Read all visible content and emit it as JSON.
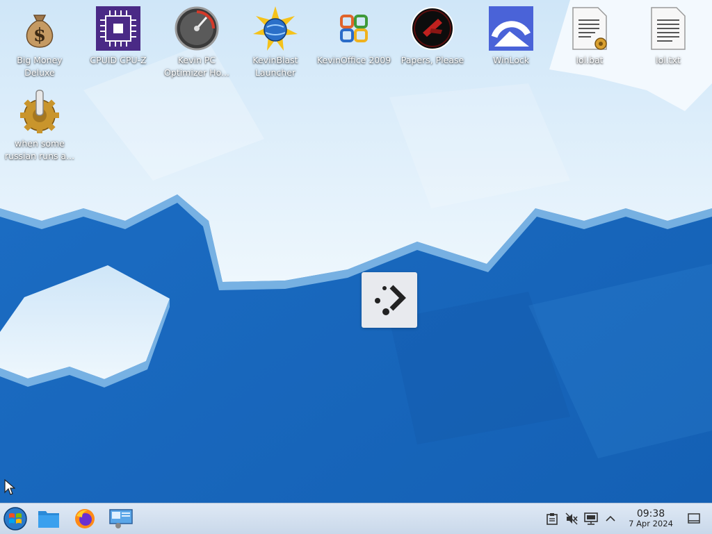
{
  "desktop": {
    "icons": [
      {
        "label": "Big Money Deluxe",
        "icon": "money-bag-icon"
      },
      {
        "label": "CPUID CPU-Z",
        "icon": "cpu-chip-icon"
      },
      {
        "label": "Kevin PC Optimizer Ho...",
        "icon": "speedometer-icon"
      },
      {
        "label": "KevinBlast Launcher",
        "icon": "globe-star-icon"
      },
      {
        "label": "KevinOffice 2009",
        "icon": "office-logo-icon"
      },
      {
        "label": "Papers, Please",
        "icon": "papers-please-icon"
      },
      {
        "label": "WinLock",
        "icon": "winlock-icon"
      },
      {
        "label": "lol.bat",
        "icon": "batch-file-icon"
      },
      {
        "label": "lol.txt",
        "icon": "text-file-icon"
      },
      {
        "label": "when some russian runs a...",
        "icon": "gear-joystick-icon"
      }
    ]
  },
  "taskbar": {
    "start": "start-button-icon",
    "pinned": [
      "file-manager-icon",
      "firefox-icon",
      "remote-desktop-icon"
    ],
    "tray": [
      "clipboard-icon",
      "speaker-muted-icon",
      "network-display-icon",
      "chevron-up-icon",
      "show-desktop-icon"
    ],
    "time": "09:38",
    "date": "7 Apr 2024"
  },
  "colors": {
    "wallpaper_blue": "#1f73c8",
    "ice": "#e4f1fb",
    "taskbar": "#d3e1f0"
  }
}
